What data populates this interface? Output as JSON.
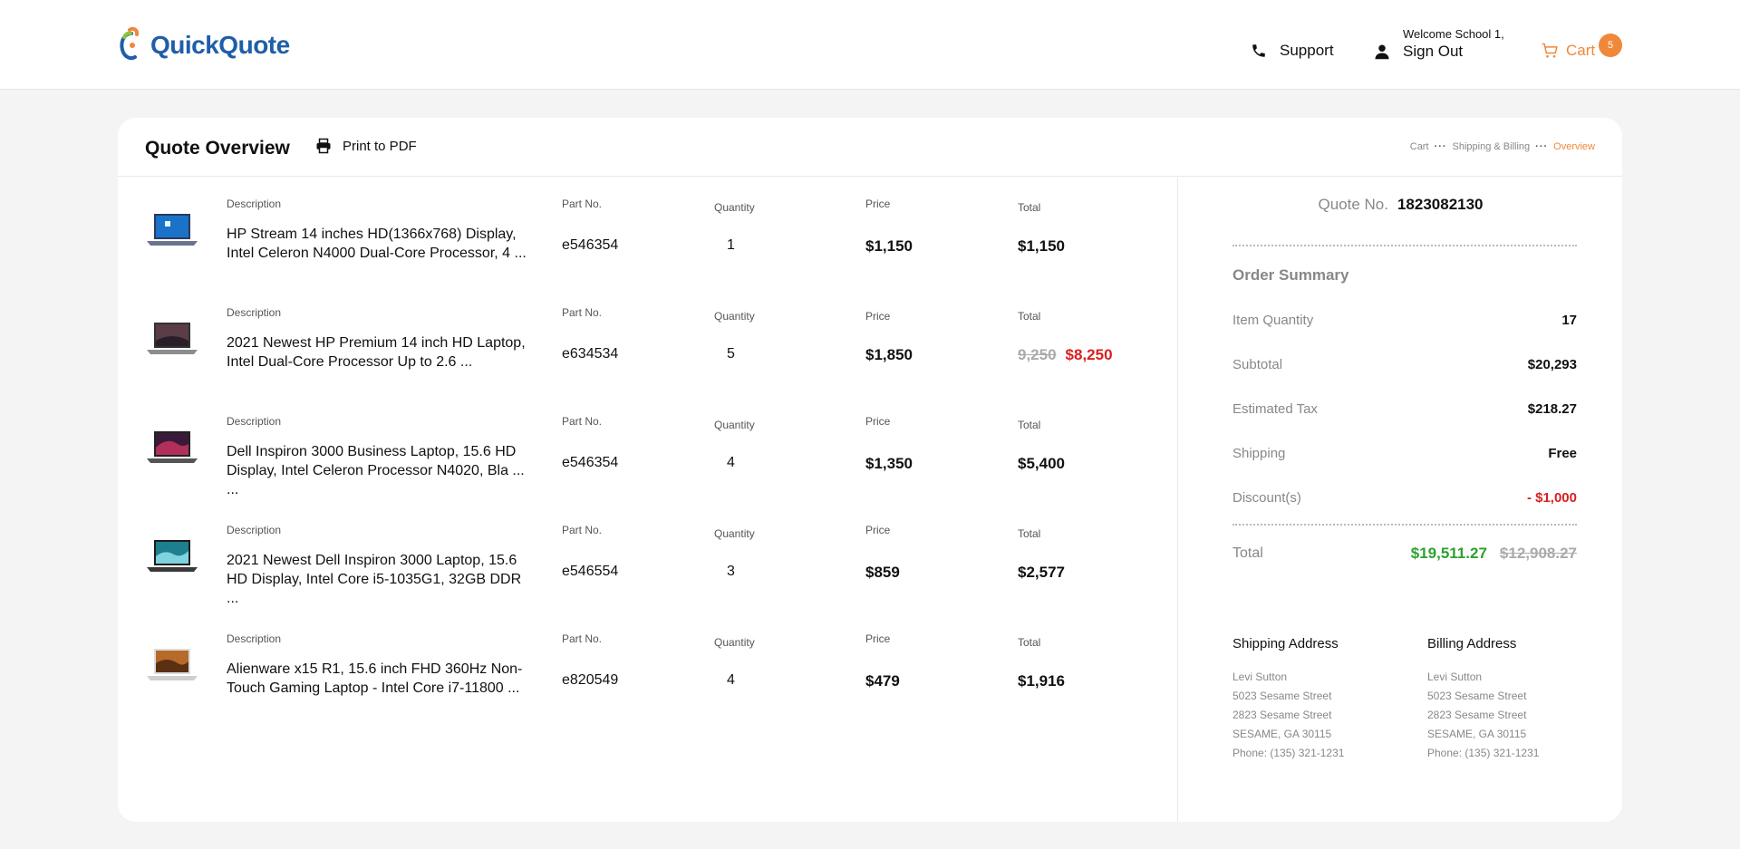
{
  "header": {
    "logo_text": "QuickQuote",
    "support_label": "Support",
    "welcome_text": "Welcome School 1,",
    "signout_label": "Sign Out",
    "cart_label": "Cart",
    "cart_count": "5"
  },
  "card": {
    "title": "Quote Overview",
    "print_label": "Print to PDF",
    "breadcrumb": [
      "Cart",
      "Shipping & Billing",
      "Overview"
    ]
  },
  "columns": {
    "description": "Description",
    "part_no": "Part No.",
    "quantity": "Quantity",
    "price": "Price",
    "total": "Total"
  },
  "items": [
    {
      "description": "HP Stream 14 inches HD(1366x768) Display, Intel Celeron N4000 Dual-Core Processor, 4 ...",
      "part_no": "e546354",
      "quantity": "1",
      "price": "$1,150",
      "total": "$1,150",
      "original_total": ""
    },
    {
      "description": "2021 Newest HP Premium 14 inch HD Laptop, Intel Dual-Core Processor Up to 2.6 ...",
      "part_no": "e634534",
      "quantity": "5",
      "price": "$1,850",
      "total": "$8,250",
      "original_total": "9,250"
    },
    {
      "description": "Dell Inspiron 3000 Business Laptop, 15.6 HD Display, Intel Celeron Processor N4020, Bla ... ...",
      "part_no": "e546354",
      "quantity": "4",
      "price": "$1,350",
      "total": "$5,400",
      "original_total": ""
    },
    {
      "description": "2021 Newest Dell Inspiron 3000 Laptop, 15.6 HD Display, Intel Core i5-1035G1, 32GB DDR ...",
      "part_no": "e546554",
      "quantity": "3",
      "price": "$859",
      "total": "$2,577",
      "original_total": ""
    },
    {
      "description": "Alienware x15 R1, 15.6 inch FHD 360Hz Non-Touch Gaming Laptop - Intel Core i7-11800 ...",
      "part_no": "e820549",
      "quantity": "4",
      "price": "$479",
      "total": "$1,916",
      "original_total": ""
    }
  ],
  "summary": {
    "quote_no_label": "Quote No.",
    "quote_no": "1823082130",
    "title": "Order Summary",
    "item_quantity_label": "Item Quantity",
    "item_quantity": "17",
    "subtotal_label": "Subtotal",
    "subtotal": "$20,293",
    "tax_label": "Estimated Tax",
    "tax": "$218.27",
    "shipping_label": "Shipping",
    "shipping": "Free",
    "discount_label": "Discount(s)",
    "discount": "- $1,000",
    "total_label": "Total",
    "total": "$19,511.27",
    "original_total": "$12,908.27"
  },
  "shipping_address": {
    "title": "Shipping Address",
    "name": "Levi Sutton",
    "line1": "5023 Sesame Street",
    "line2": "2823 Sesame Street",
    "city": "SESAME, GA 30115",
    "phone": "Phone: (135) 321-1231"
  },
  "billing_address": {
    "title": "Billing Address",
    "name": "Levi Sutton",
    "line1": "5023 Sesame Street",
    "line2": "2823 Sesame Street",
    "city": "SESAME, GA 30115",
    "phone": "Phone: (135) 321-1231"
  },
  "colors": {
    "accent": "#f0883a",
    "brand": "#1f5ea8",
    "discount": "#d92020",
    "total_green": "#2ea02e"
  },
  "icons": [
    "quickquote-logo-icon",
    "phone-icon",
    "user-icon",
    "cart-icon",
    "printer-icon",
    "laptop-icon"
  ]
}
